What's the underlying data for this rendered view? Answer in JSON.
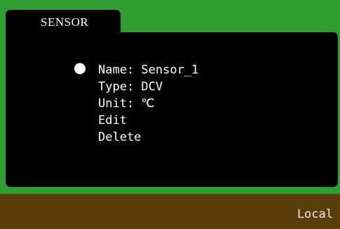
{
  "tab": {
    "label": "SENSOR"
  },
  "menu": {
    "selected_index": 0,
    "items": [
      {
        "label": "Name: Sensor_1"
      },
      {
        "label": "Type: DCV"
      },
      {
        "label": "Unit: ℃"
      },
      {
        "label": "Edit"
      },
      {
        "label": "Delete"
      }
    ]
  },
  "status_bar": {
    "text": "Local"
  },
  "colors": {
    "frame_green": "#2e9e33",
    "panel_black": "#000000",
    "status_brown": "#5a3e0c",
    "text_white": "#ffffff"
  }
}
